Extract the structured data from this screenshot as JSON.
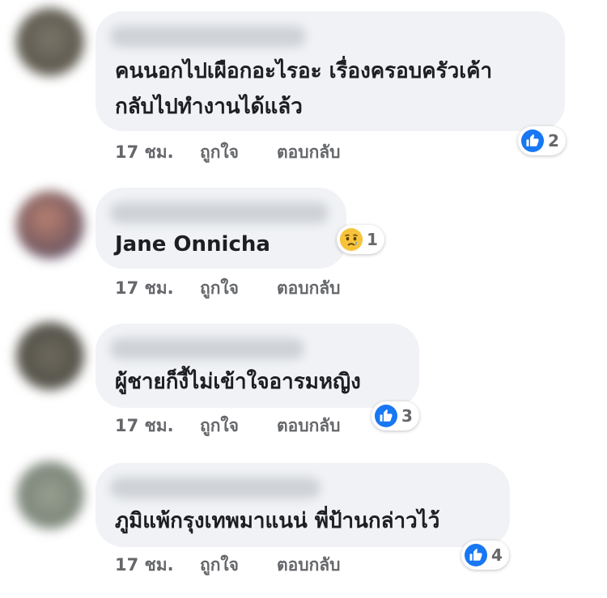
{
  "comments": [
    {
      "text_lines": [
        "คนนอกไปเผือกอะไรอะ เรื่องครอบครัวเค้า",
        "กลับไปทำงานได้แล้ว"
      ],
      "time": "17 ชม.",
      "like_label": "ถูกใจ",
      "reply_label": "ตอบกลับ",
      "reaction": {
        "icon": "like-icon",
        "count": "2",
        "color": "#1877f2"
      },
      "avatar_color": "#6b6759"
    },
    {
      "text_lines": [
        "Jane Onnicha"
      ],
      "time": "17 ชม.",
      "like_label": "ถูกใจ",
      "reply_label": "ตอบกลับ",
      "reaction": {
        "icon": "sad-face-icon",
        "count": "1",
        "color": "#f7c33b"
      },
      "avatar_color": "#8a5a5a"
    },
    {
      "text_lines": [
        "ผู้ชายก็งี้ไม่เข้าใจอารมหญิง"
      ],
      "time": "17 ชม.",
      "like_label": "ถูกใจ",
      "reply_label": "ตอบกลับ",
      "reaction": {
        "icon": "like-icon",
        "count": "3",
        "color": "#1877f2"
      },
      "avatar_color": "#5c5a50"
    },
    {
      "text_lines": [
        "ภูมิแพ้กรุงเทพมาแนน่ พี่ป้านกล่าวไว้"
      ],
      "time": "17 ชม.",
      "like_label": "ถูกใจ",
      "reply_label": "ตอบกลับ",
      "reaction": {
        "icon": "like-icon",
        "count": "4",
        "color": "#1877f2"
      },
      "avatar_color": "#8e9788"
    }
  ]
}
